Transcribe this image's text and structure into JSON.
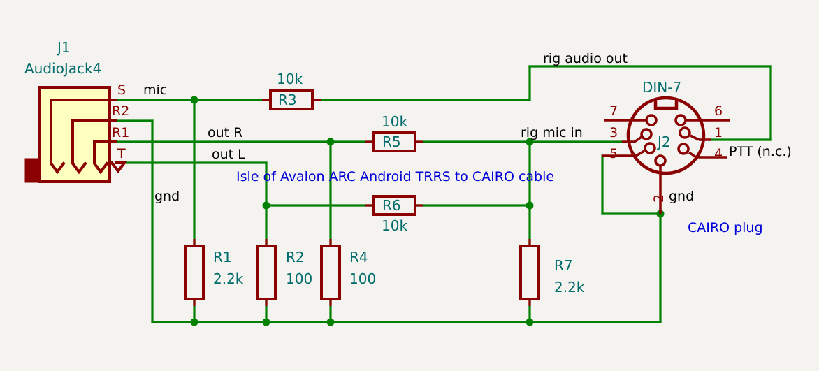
{
  "sheet": {
    "title_note": "Isle of Avalon ARC Android TRRS to CAIRO cable",
    "plug_note": "CAIRO plug",
    "background_color": "#f4f3ef",
    "wire_color": "#008000",
    "component_color": "#8b0000",
    "ref_color": "#006b6b",
    "note_color": "#0000d8",
    "net_label_color": "#000000"
  },
  "connectors": {
    "j1": {
      "ref": "J1",
      "value": "AudioJack4",
      "pins": [
        {
          "name": "S",
          "net": "mic"
        },
        {
          "name": "R2",
          "net": "gnd"
        },
        {
          "name": "R1",
          "net": "out R"
        },
        {
          "name": "T",
          "net": "out L"
        }
      ]
    },
    "j2": {
      "ref": "J2",
      "value": "DIN-7",
      "pins": [
        {
          "number": "7",
          "side": "left",
          "net": ""
        },
        {
          "number": "3",
          "side": "left",
          "net": "rig mic in"
        },
        {
          "number": "5",
          "side": "left",
          "net": "gnd"
        },
        {
          "number": "6",
          "side": "right",
          "net": ""
        },
        {
          "number": "1",
          "side": "right",
          "net": "rig audio out"
        },
        {
          "number": "4",
          "side": "right",
          "net": "PTT (n.c.)"
        },
        {
          "number": "2",
          "side": "bottom",
          "net": "gnd"
        }
      ]
    }
  },
  "net_labels": {
    "mic": "mic",
    "out_r": "out R",
    "out_l": "out L",
    "gnd_left": "gnd",
    "gnd_right": "gnd",
    "rig_audio_out": "rig audio out",
    "rig_mic_in": "rig mic in",
    "ptt": "PTT (n.c.)"
  },
  "resistors": [
    {
      "ref": "R3",
      "value": "10k",
      "orientation": "horizontal"
    },
    {
      "ref": "R5",
      "value": "10k",
      "orientation": "horizontal"
    },
    {
      "ref": "R6",
      "value": "10k",
      "orientation": "horizontal"
    },
    {
      "ref": "R1",
      "value": "2.2k",
      "orientation": "vertical"
    },
    {
      "ref": "R2",
      "value": "100",
      "orientation": "vertical"
    },
    {
      "ref": "R4",
      "value": "100",
      "orientation": "vertical"
    },
    {
      "ref": "R7",
      "value": "2.2k",
      "orientation": "vertical"
    }
  ]
}
